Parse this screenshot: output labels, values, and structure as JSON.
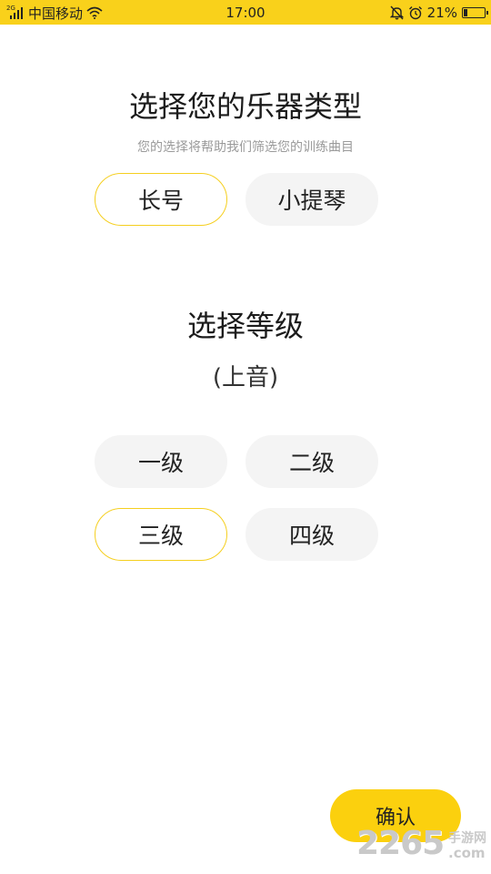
{
  "status_bar": {
    "network_tag": "2G",
    "carrier": "中国移动",
    "time": "17:00",
    "battery_percent": "21%",
    "battery_level": 0.21,
    "background_color": "#f9d11b",
    "icons": [
      "signal-icon",
      "wifi-icon",
      "bell-muted-icon",
      "alarm-clock-icon",
      "battery-icon"
    ]
  },
  "instrument_section": {
    "title": "选择您的乐器类型",
    "subtitle": "您的选择将帮助我们筛选您的训练曲目",
    "options": [
      {
        "label": "长号",
        "selected": true
      },
      {
        "label": "小提琴",
        "selected": false
      }
    ]
  },
  "level_section": {
    "title": "选择等级",
    "subtitle": "(上音)",
    "options": [
      {
        "label": "一级",
        "selected": false
      },
      {
        "label": "二级",
        "selected": false
      },
      {
        "label": "三级",
        "selected": true
      },
      {
        "label": "四级",
        "selected": false
      }
    ]
  },
  "confirm_button": {
    "label": "确认"
  },
  "watermark": {
    "number": "2265",
    "text": "手游网",
    "suffix": ".com"
  },
  "colors": {
    "accent": "#f9d11b",
    "selected_border": "#f5cf1f",
    "pill_background": "#f4f4f4",
    "subtitle_text": "#9a9a9a"
  }
}
